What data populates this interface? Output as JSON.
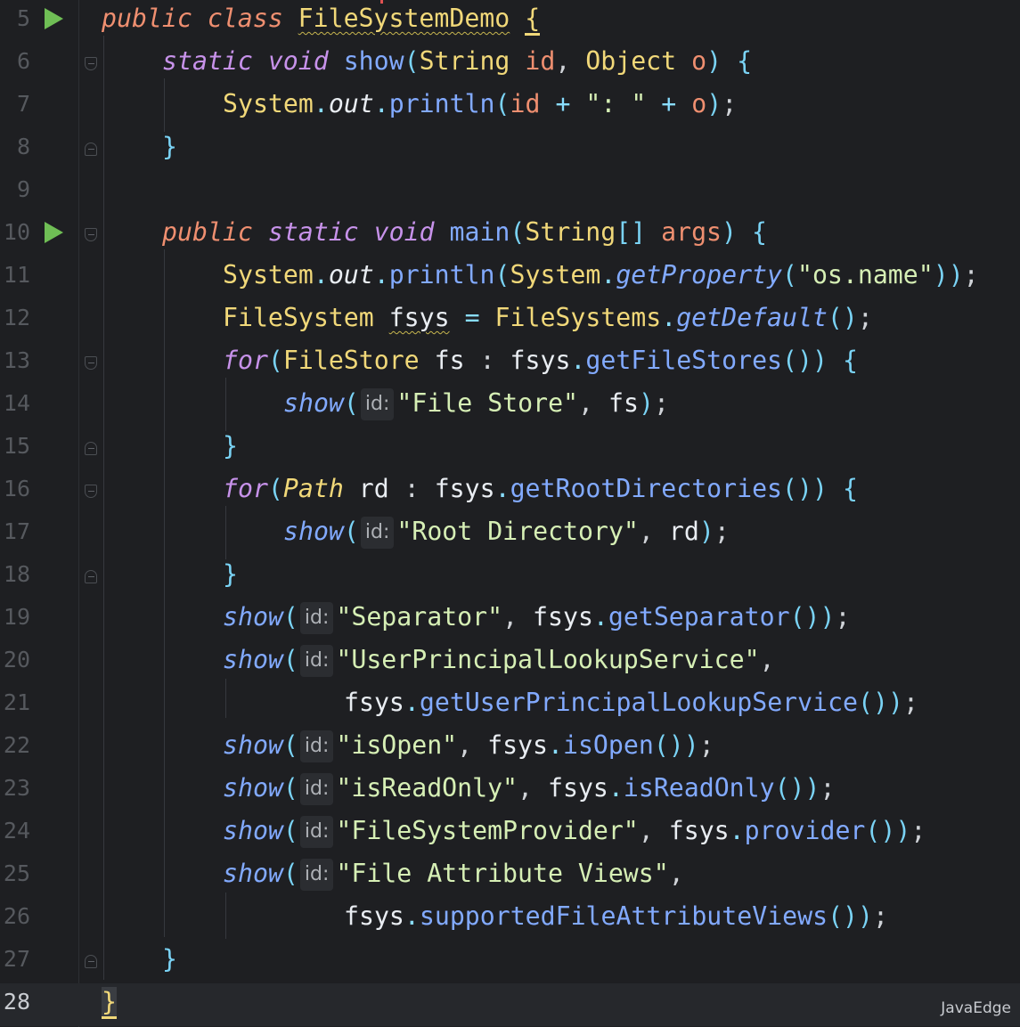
{
  "editor": {
    "current_line": 28,
    "lines": [
      {
        "num": "5",
        "run": true,
        "fold": null
      },
      {
        "num": "6",
        "run": false,
        "fold": "open"
      },
      {
        "num": "7",
        "run": false,
        "fold": null
      },
      {
        "num": "8",
        "run": false,
        "fold": "close"
      },
      {
        "num": "9",
        "run": false,
        "fold": null
      },
      {
        "num": "10",
        "run": true,
        "fold": "open"
      },
      {
        "num": "11",
        "run": false,
        "fold": null
      },
      {
        "num": "12",
        "run": false,
        "fold": null
      },
      {
        "num": "13",
        "run": false,
        "fold": "open"
      },
      {
        "num": "14",
        "run": false,
        "fold": null
      },
      {
        "num": "15",
        "run": false,
        "fold": "close"
      },
      {
        "num": "16",
        "run": false,
        "fold": "open"
      },
      {
        "num": "17",
        "run": false,
        "fold": null
      },
      {
        "num": "18",
        "run": false,
        "fold": "close"
      },
      {
        "num": "19",
        "run": false,
        "fold": null
      },
      {
        "num": "20",
        "run": false,
        "fold": null
      },
      {
        "num": "21",
        "run": false,
        "fold": null
      },
      {
        "num": "22",
        "run": false,
        "fold": null
      },
      {
        "num": "23",
        "run": false,
        "fold": null
      },
      {
        "num": "24",
        "run": false,
        "fold": null
      },
      {
        "num": "25",
        "run": false,
        "fold": null
      },
      {
        "num": "26",
        "run": false,
        "fold": null
      },
      {
        "num": "27",
        "run": false,
        "fold": "close"
      },
      {
        "num": "28",
        "run": false,
        "fold": null
      }
    ],
    "code": {
      "l5": {
        "kw_public": "public",
        "kw_class": "class",
        "class_name": "FileSystemDemo",
        "brace": "{"
      },
      "l6": {
        "kw_static": "static",
        "kw_void": "void",
        "method": "show",
        "p1": "(",
        "type1": "String",
        "id": "id",
        "comma": ",",
        "type2": "Object",
        "o": "o",
        "p2": ")",
        "brace": "{"
      },
      "l7": {
        "system": "System",
        "dot1": ".",
        "out": "out",
        "dot2": ".",
        "println": "println",
        "p1": "(",
        "id": "id",
        "plus1": "+",
        "str": "\": \"",
        "plus2": "+",
        "o": "o",
        "p2": ")",
        "semi": ";"
      },
      "l8": {
        "brace": "}"
      },
      "l10": {
        "kw_public": "public",
        "kw_static": "static",
        "kw_void": "void",
        "method": "main",
        "p1": "(",
        "type": "String",
        "arr": "[]",
        "args": "args",
        "p2": ")",
        "brace": "{"
      },
      "l11": {
        "system": "System",
        "dot1": ".",
        "out": "out",
        "dot2": ".",
        "println": "println",
        "p1": "(",
        "system2": "System",
        "dot3": ".",
        "getprop": "getProperty",
        "p2": "(",
        "str": "\"os.name\"",
        "p3": "))",
        "semi": ";"
      },
      "l12": {
        "type": "FileSystem",
        "var": "fsys",
        "eq": "=",
        "cls": "FileSystems",
        "dot": ".",
        "getdefault": "getDefault",
        "parens": "()",
        "semi": ";"
      },
      "l13": {
        "kw_for": "for",
        "p1": "(",
        "type": "FileStore",
        "var": "fs",
        "colon": ":",
        "fsys": "fsys",
        "dot": ".",
        "call": "getFileStores",
        "parens": "())",
        "brace": "{"
      },
      "l14": {
        "show": "show",
        "p1": "(",
        "hint": "id:",
        "str": "\"File Store\"",
        "comma": ",",
        "arg": "fs",
        "p2": ")",
        "semi": ";"
      },
      "l15": {
        "brace": "}"
      },
      "l16": {
        "kw_for": "for",
        "p1": "(",
        "type": "Path",
        "var": "rd",
        "colon": ":",
        "fsys": "fsys",
        "dot": ".",
        "call": "getRootDirectories",
        "parens": "())",
        "brace": "{"
      },
      "l17": {
        "show": "show",
        "p1": "(",
        "hint": "id:",
        "str": "\"Root Directory\"",
        "comma": ",",
        "arg": "rd",
        "p2": ")",
        "semi": ";"
      },
      "l18": {
        "brace": "}"
      },
      "l19": {
        "show": "show",
        "p1": "(",
        "hint": "id:",
        "str": "\"Separator\"",
        "comma": ",",
        "fsys": "fsys",
        "dot": ".",
        "call": "getSeparator",
        "parens": "())",
        "semi": ";"
      },
      "l20": {
        "show": "show",
        "p1": "(",
        "hint": "id:",
        "str": "\"UserPrincipalLookupService\"",
        "comma": ","
      },
      "l21": {
        "fsys": "fsys",
        "dot": ".",
        "call": "getUserPrincipalLookupService",
        "parens": "())",
        "semi": ";"
      },
      "l22": {
        "show": "show",
        "p1": "(",
        "hint": "id:",
        "str": "\"isOpen\"",
        "comma": ",",
        "fsys": "fsys",
        "dot": ".",
        "call": "isOpen",
        "parens": "())",
        "semi": ";"
      },
      "l23": {
        "show": "show",
        "p1": "(",
        "hint": "id:",
        "str": "\"isReadOnly\"",
        "comma": ",",
        "fsys": "fsys",
        "dot": ".",
        "call": "isReadOnly",
        "parens": "())",
        "semi": ";"
      },
      "l24": {
        "show": "show",
        "p1": "(",
        "hint": "id:",
        "str": "\"FileSystemProvider\"",
        "comma": ",",
        "fsys": "fsys",
        "dot": ".",
        "call": "provider",
        "parens": "())",
        "semi": ";"
      },
      "l25": {
        "show": "show",
        "p1": "(",
        "hint": "id:",
        "str": "\"File Attribute Views\"",
        "comma": ","
      },
      "l26": {
        "fsys": "fsys",
        "dot": ".",
        "call": "supportedFileAttributeViews",
        "parens": "())",
        "semi": ";"
      },
      "l27": {
        "brace": "}"
      },
      "l28": {
        "brace": "}"
      }
    }
  },
  "watermark": "JavaEdge",
  "colors": {
    "background": "#1e1f22",
    "keyword": "#ef8f70",
    "keyword_purple": "#c792ea",
    "class": "#f1d879",
    "function": "#82aaff",
    "string": "#d6efb5",
    "operator": "#89ddff",
    "run_icon": "#6fbe55"
  }
}
